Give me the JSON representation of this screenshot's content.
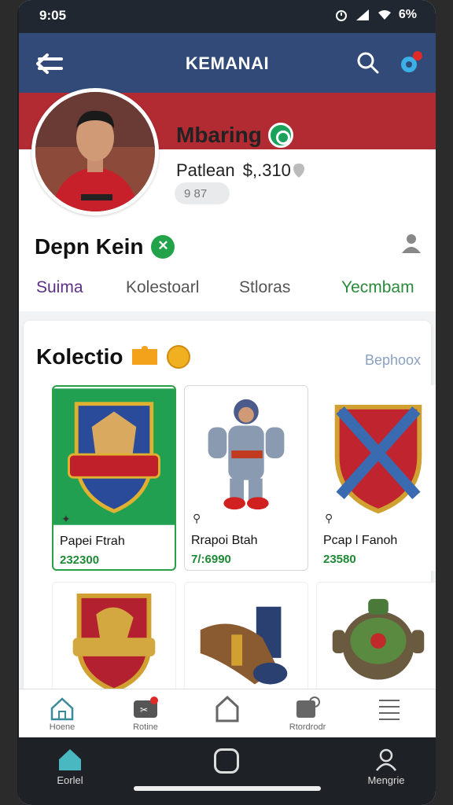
{
  "status": {
    "time": "9:05",
    "battery": "6%"
  },
  "appbar": {
    "title": "KEMANAI"
  },
  "hero": {
    "name": "Mbaring",
    "balance_label": "Patlean",
    "balance_value": "$,.310",
    "pill": "9 87"
  },
  "profile": {
    "username": "Depn Kein"
  },
  "tabs": [
    "Suima",
    "Kolestoarl",
    "Stloras",
    "Yecmbam"
  ],
  "collection": {
    "title": "Kolectio",
    "link": "Bephoox",
    "cards": [
      {
        "name": "Papei Ftrah",
        "price": "232300",
        "icon": "wolf-crest-shield"
      },
      {
        "name": "Rrapoi Btah",
        "price": "7/:6990",
        "icon": "armored-warrior"
      },
      {
        "name": "Pcap l Fanoh",
        "price": "23580",
        "icon": "crossed-shield"
      },
      {
        "name": "",
        "price": "",
        "icon": "eagle-crest-shield"
      },
      {
        "name": "",
        "price": "",
        "icon": "cannon"
      },
      {
        "name": "",
        "price": "",
        "icon": "armor-pot"
      }
    ]
  },
  "nav": [
    {
      "label": "Hoene",
      "icon": "home-icon"
    },
    {
      "label": "Rotine",
      "icon": "game-icon"
    },
    {
      "label": "",
      "icon": "tag-icon"
    },
    {
      "label": "Rtordrodr",
      "icon": "store-icon"
    },
    {
      "label": "",
      "icon": "menu-icon"
    }
  ],
  "system": {
    "left_label": "Eorlel",
    "right_label": "Mengrie"
  },
  "colors": {
    "appbar": "#324a78",
    "band": "#b22a32",
    "accent_green": "#2aa046",
    "tab_active": "#5b2f86"
  }
}
